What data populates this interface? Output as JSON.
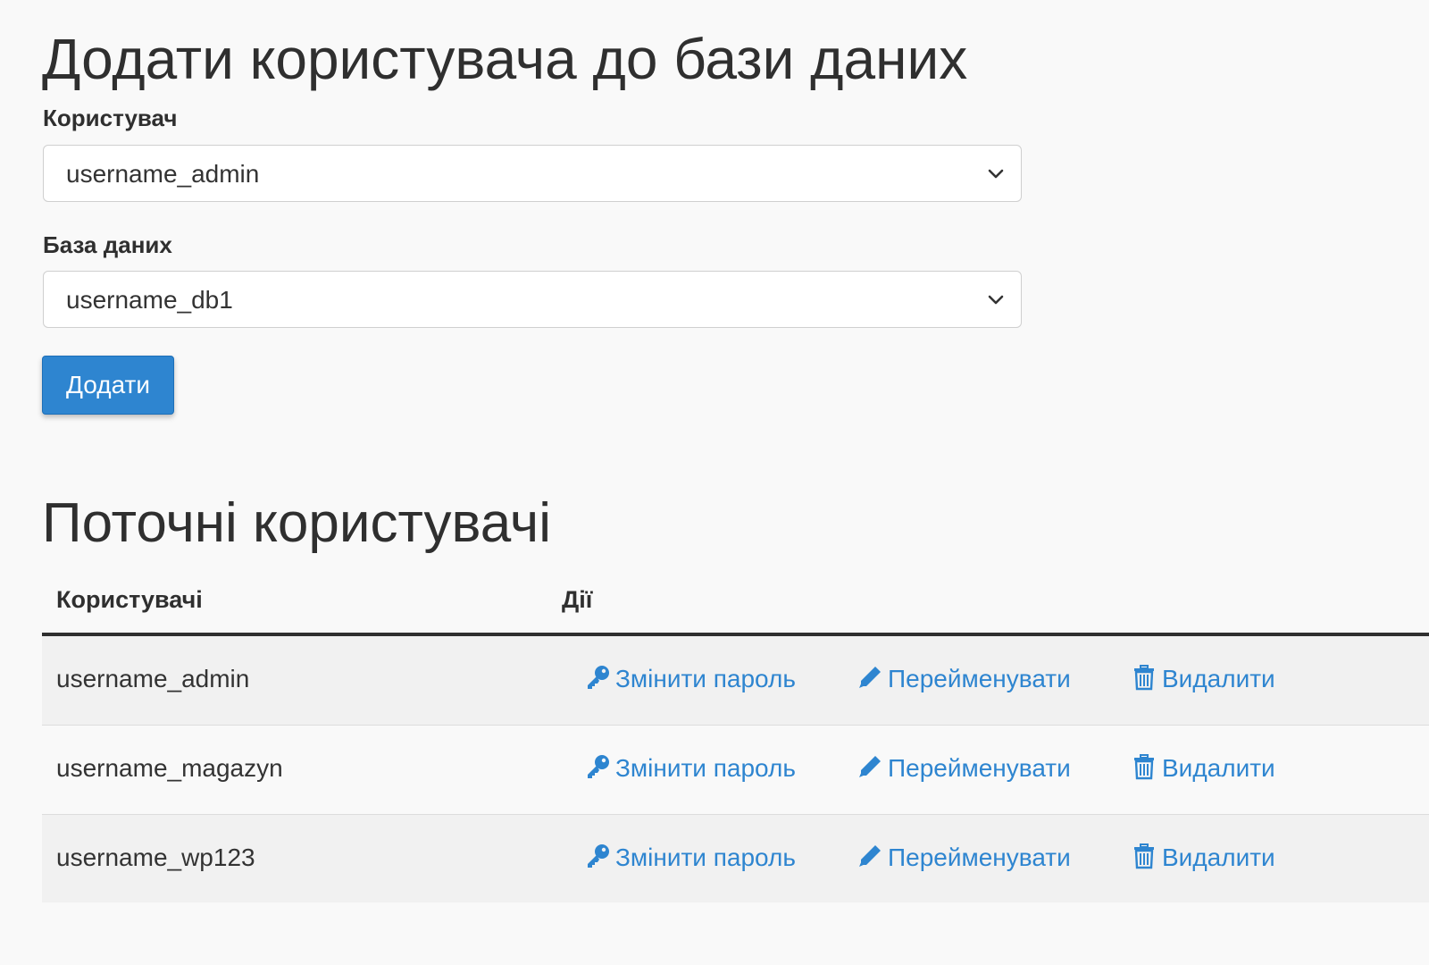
{
  "add_form": {
    "title": "Додати користувача до бази даних",
    "user_label": "Користувач",
    "user_selected": "username_admin",
    "db_label": "База даних",
    "db_selected": "username_db1",
    "submit_label": "Додати"
  },
  "current_users": {
    "title": "Поточні користувачі",
    "columns": [
      "Користувачі",
      "Дії"
    ],
    "actions": {
      "change_password": "Змінити пароль",
      "rename": "Перейменувати",
      "delete": "Видалити"
    },
    "rows": [
      {
        "user": "username_admin"
      },
      {
        "user": "username_magazyn"
      },
      {
        "user": "username_wp123"
      }
    ]
  },
  "colors": {
    "accent": "#2e85d0",
    "text": "#333333",
    "background": "#f9f9f9",
    "row_stripe": "#f1f1f1"
  },
  "icons": {
    "select_arrow": "chevron-down-icon",
    "change_password": "key-icon",
    "rename": "pencil-icon",
    "delete": "trash-icon"
  }
}
